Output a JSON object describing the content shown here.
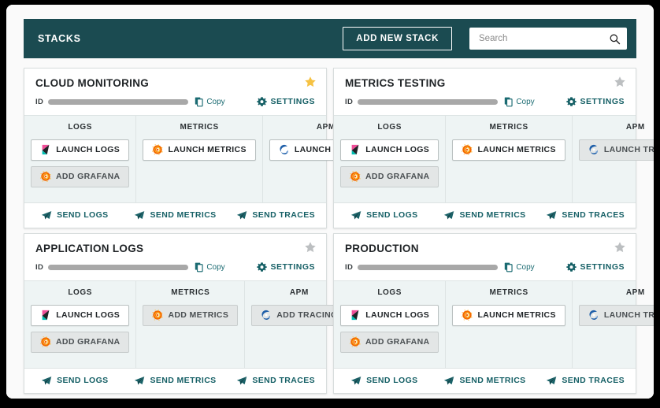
{
  "header": {
    "title": "STACKS",
    "add_button_label": "ADD NEW STACK",
    "search_placeholder": "Search",
    "search_value": "",
    "search_icon": "search-icon",
    "bar_color": "#1b4b51"
  },
  "labels": {
    "id_label": "ID",
    "copy_label": "Copy",
    "copy_icon": "copy-icon",
    "settings_label": "SETTINGS",
    "gear_icon": "gear-icon",
    "star_icon": "star-icon",
    "star_on_color": "#f5c councils",
    "col_logs": "LOGS",
    "col_metrics": "METRICS",
    "col_apm": "APM",
    "send_logs": "SEND LOGS",
    "send_metrics": "SEND METRICS",
    "send_traces": "SEND TRACES",
    "send_icon": "send-icon"
  },
  "colors": {
    "teal_dark": "#1b4b51",
    "teal_link": "#166066",
    "panel_bg": "#eef4f4",
    "star_filled": "#f6c243",
    "star_empty": "#bcbfc1",
    "kibana_pink": "#f04e98",
    "kibana_cyan": "#00bfb3",
    "grafana_orange": "#f46800",
    "grafana_yellow": "#fcbb2e",
    "tracing_blue": "#1f5fa9"
  },
  "cards": [
    {
      "title": "CLOUD MONITORING",
      "favorited": true,
      "logs": [
        {
          "label": "LAUNCH LOGS",
          "icon": "kibana-icon",
          "state": "primary"
        },
        {
          "label": "ADD GRAFANA",
          "icon": "grafana-icon",
          "state": "muted"
        }
      ],
      "metrics": [
        {
          "label": "LAUNCH METRICS",
          "icon": "grafana-icon",
          "state": "primary"
        }
      ],
      "apm": [
        {
          "label": "LAUNCH TRACING",
          "icon": "tracing-icon",
          "state": "primary"
        }
      ]
    },
    {
      "title": "METRICS TESTING",
      "favorited": false,
      "logs": [
        {
          "label": "LAUNCH LOGS",
          "icon": "kibana-icon",
          "state": "primary"
        },
        {
          "label": "ADD GRAFANA",
          "icon": "grafana-icon",
          "state": "muted"
        }
      ],
      "metrics": [
        {
          "label": "LAUNCH METRICS",
          "icon": "grafana-icon",
          "state": "primary"
        }
      ],
      "apm": [
        {
          "label": "LAUNCH TRACING",
          "icon": "tracing-icon",
          "state": "muted"
        }
      ]
    },
    {
      "title": "APPLICATION LOGS",
      "favorited": false,
      "logs": [
        {
          "label": "LAUNCH LOGS",
          "icon": "kibana-icon",
          "state": "primary"
        },
        {
          "label": "ADD GRAFANA",
          "icon": "grafana-icon",
          "state": "muted"
        }
      ],
      "metrics": [
        {
          "label": "ADD METRICS",
          "icon": "grafana-icon",
          "state": "muted"
        }
      ],
      "apm": [
        {
          "label": "ADD TRACING",
          "icon": "tracing-icon",
          "state": "muted"
        }
      ]
    },
    {
      "title": "PRODUCTION",
      "favorited": false,
      "logs": [
        {
          "label": "LAUNCH LOGS",
          "icon": "kibana-icon",
          "state": "primary"
        },
        {
          "label": "ADD GRAFANA",
          "icon": "grafana-icon",
          "state": "muted"
        }
      ],
      "metrics": [
        {
          "label": "LAUNCH METRICS",
          "icon": "grafana-icon",
          "state": "primary"
        }
      ],
      "apm": [
        {
          "label": "LAUNCH TRACING",
          "icon": "tracing-icon",
          "state": "muted"
        }
      ]
    }
  ]
}
